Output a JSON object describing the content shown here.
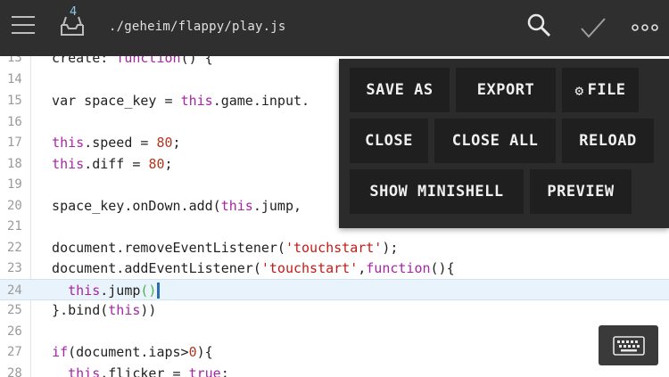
{
  "topbar": {
    "inbox_badge": "4",
    "file_path": "./geheim/flappy/play.js",
    "icons": {
      "menu": "hamburger-menu-icon",
      "inbox": "inbox-tray-icon",
      "search": "search-icon",
      "confirm": "checkmark-icon",
      "more": "more-options-icon"
    }
  },
  "editor": {
    "active_line": "24",
    "lines": [
      {
        "n": "15",
        "parts": [
          [
            "",
            "  var space_key = "
          ],
          [
            "kw",
            "this"
          ],
          [
            "",
            ".game.input."
          ]
        ]
      },
      {
        "n": "16",
        "parts": []
      },
      {
        "n": "17",
        "parts": [
          [
            "",
            "  "
          ],
          [
            "kw",
            "this"
          ],
          [
            "",
            ".speed = "
          ],
          [
            "num",
            "80"
          ],
          [
            "",
            ";"
          ]
        ]
      },
      {
        "n": "18",
        "parts": [
          [
            "",
            "  "
          ],
          [
            "kw",
            "this"
          ],
          [
            "",
            ".diff = "
          ],
          [
            "num",
            "80"
          ],
          [
            "",
            ";"
          ]
        ]
      },
      {
        "n": "19",
        "parts": []
      },
      {
        "n": "20",
        "parts": [
          [
            "",
            "  space_key.onDown.add("
          ],
          [
            "kw",
            "this"
          ],
          [
            "",
            ".jump,"
          ]
        ]
      },
      {
        "n": "21",
        "parts": []
      },
      {
        "n": "22",
        "parts": [
          [
            "",
            "  document.removeEventListener("
          ],
          [
            "str",
            "'touchstart'"
          ],
          [
            "",
            ");"
          ]
        ]
      },
      {
        "n": "23",
        "parts": [
          [
            "",
            "  document.addEventListener("
          ],
          [
            "str",
            "'touchstart'"
          ],
          [
            "",
            ","
          ],
          [
            "kw",
            "function"
          ],
          [
            "",
            "(){"
          ]
        ]
      },
      {
        "n": "24",
        "parts": [
          [
            "",
            "    "
          ],
          [
            "kw",
            "this"
          ],
          [
            "",
            ".jump"
          ],
          [
            "paren",
            "()"
          ]
        ]
      },
      {
        "n": "25",
        "parts": [
          [
            "",
            "  }.bind("
          ],
          [
            "kw",
            "this"
          ],
          [
            "",
            "))"
          ]
        ]
      },
      {
        "n": "26",
        "parts": []
      },
      {
        "n": "27",
        "parts": [
          [
            "",
            "  "
          ],
          [
            "kw",
            "if"
          ],
          [
            "",
            "(document.iaps>"
          ],
          [
            "num",
            "0"
          ],
          [
            "",
            "){"
          ]
        ]
      },
      {
        "n": "28",
        "parts": [
          [
            "",
            "    "
          ],
          [
            "kw",
            "this"
          ],
          [
            "",
            ".flicker = "
          ],
          [
            "kw",
            "true"
          ],
          [
            "",
            ";"
          ]
        ]
      }
    ],
    "partial_top_line": {
      "n": "13",
      "parts": [
        [
          "",
          "  create: "
        ],
        [
          "kw",
          "function"
        ],
        [
          "",
          "() {"
        ]
      ]
    },
    "line_14": {
      "n": "14"
    }
  },
  "menu": {
    "save_as": "SAVE AS",
    "export": "EXPORT",
    "file": "FILE",
    "close": "CLOSE",
    "close_all": "CLOSE ALL",
    "reload": "RELOAD",
    "show_minishell": "SHOW MINISHELL",
    "preview": "PREVIEW",
    "file_icon": "gear-icon"
  },
  "keyboard_toggle": {
    "icon": "keyboard-icon"
  },
  "colors": {
    "topbar_bg": "#2f2f2f",
    "menu_bg": "#2b2b2b",
    "menu_button_bg": "#1f1f1f",
    "keyword": "#a626a4",
    "number": "#b0381e",
    "string": "#c41a16",
    "active_line_bg": "#e9f3fc"
  }
}
